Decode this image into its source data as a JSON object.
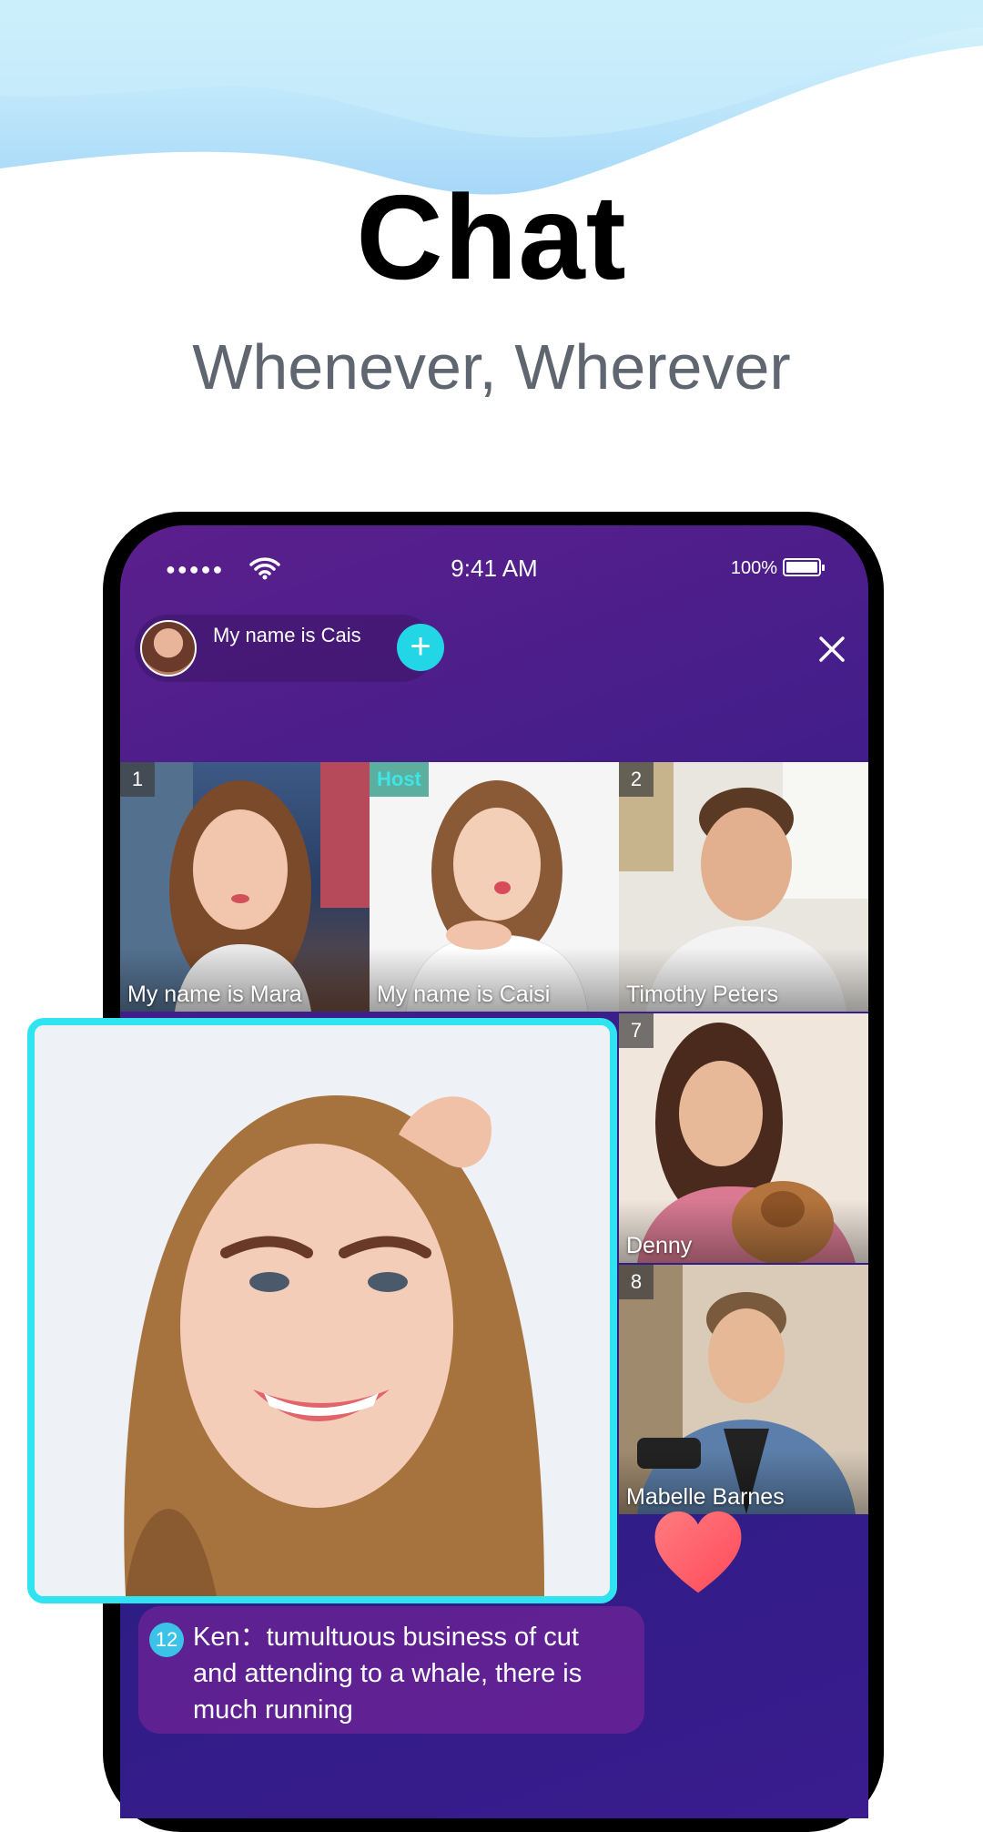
{
  "headline": {
    "title": "Chat",
    "subtitle": "Whenever, Wherever"
  },
  "status_bar": {
    "signal": "●●●●●",
    "time": "9:41 AM",
    "battery": "100%"
  },
  "room": {
    "host_name": "My name is Cais",
    "add_icon": "plus-icon",
    "close_icon": "close-icon"
  },
  "tiles": [
    {
      "badge": "1",
      "name": "My name is Mara"
    },
    {
      "badge": "Host",
      "name": "My name is Caisi"
    },
    {
      "badge": "2",
      "name": "Timothy Peters"
    },
    {
      "badge": "7",
      "name": "Denny"
    },
    {
      "badge": "8",
      "name": "Mabelle Barnes"
    }
  ],
  "chat": {
    "level": "12",
    "message": "Ken：tumultuous business of cut and attending to a whale, there is much running"
  },
  "colors": {
    "accent": "#2fe4f0",
    "heart": "#ff5a6a"
  }
}
